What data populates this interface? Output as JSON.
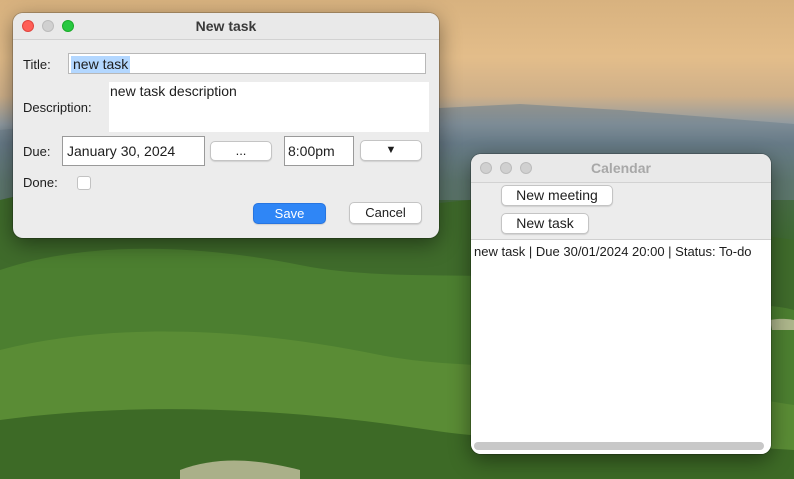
{
  "new_task_window": {
    "title": "New task",
    "title_label": "Title:",
    "title_value": "new task",
    "description_label": "Description:",
    "description_value": "new task description",
    "due_label": "Due:",
    "due_date": "January 30, 2024",
    "date_picker_label": "...",
    "due_time": "8:00pm",
    "time_dropdown_label": "▼",
    "done_label": "Done:",
    "done_checked": false,
    "save_label": "Save",
    "cancel_label": "Cancel"
  },
  "calendar_window": {
    "title": "Calendar",
    "new_meeting_label": "New meeting",
    "new_task_label": "New task",
    "items": [
      {
        "text": "new task | Due 30/01/2024 20:00 | Status: To-do"
      }
    ]
  },
  "colors": {
    "accent_button": "#2f86f6",
    "selection": "#b3d7ff",
    "traffic_red": "#ff5f57",
    "traffic_yellow": "#febc2e",
    "traffic_green": "#28c840"
  }
}
